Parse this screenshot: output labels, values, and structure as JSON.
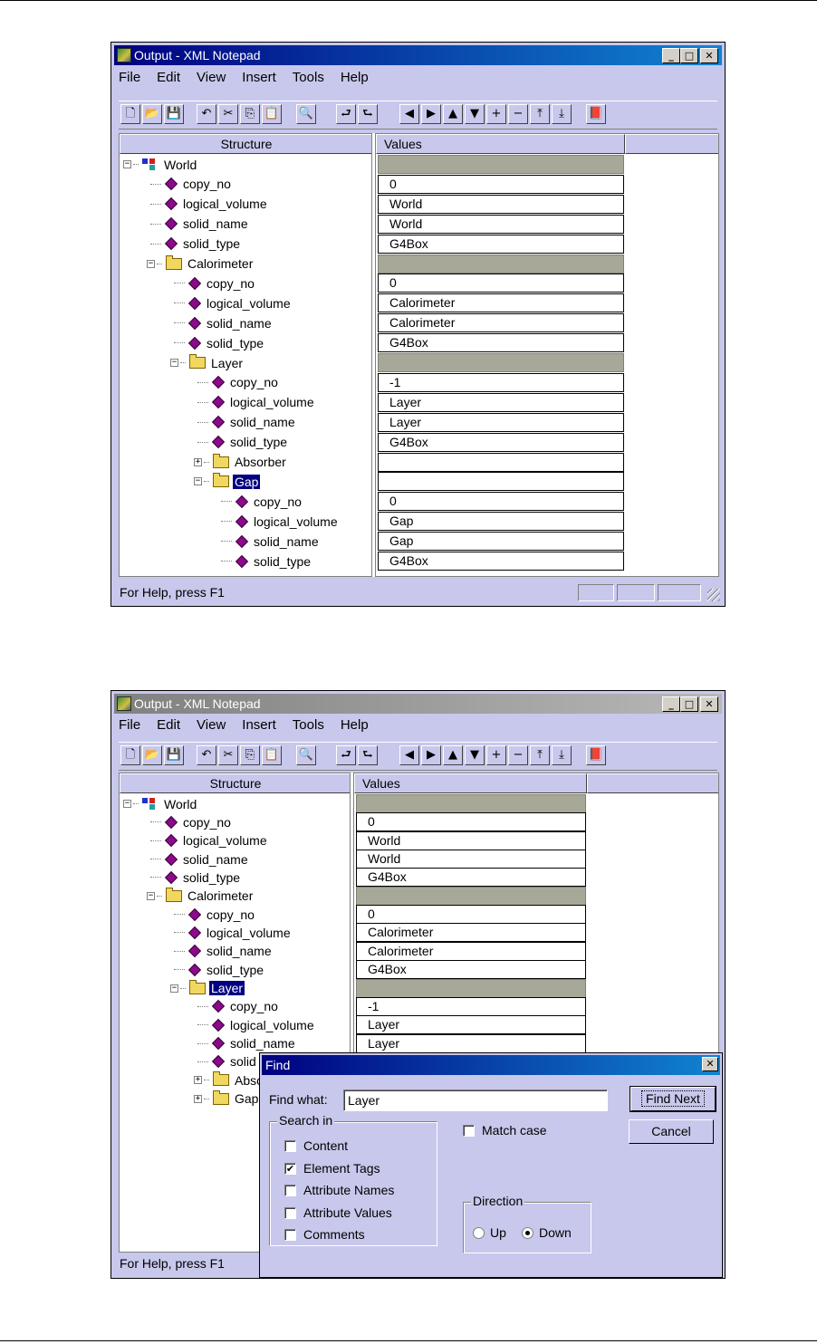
{
  "screen1": {
    "title": "Output - XML Notepad",
    "menu": [
      "File",
      "Edit",
      "View",
      "Insert",
      "Tools",
      "Help"
    ],
    "headers": {
      "structure": "Structure",
      "values": "Values"
    },
    "status": "For Help, press F1",
    "rows": [
      {
        "label": "World",
        "type": "root",
        "value": ""
      },
      {
        "label": "copy_no",
        "type": "attr",
        "value": "0"
      },
      {
        "label": "logical_volume",
        "type": "attr",
        "value": "World"
      },
      {
        "label": "solid_name",
        "type": "attr",
        "value": "World"
      },
      {
        "label": "solid_type",
        "type": "attr",
        "value": "G4Box"
      },
      {
        "label": "Calorimeter",
        "type": "folder",
        "value": ""
      },
      {
        "label": "copy_no",
        "type": "attr",
        "value": "0"
      },
      {
        "label": "logical_volume",
        "type": "attr",
        "value": "Calorimeter"
      },
      {
        "label": "solid_name",
        "type": "attr",
        "value": "Calorimeter"
      },
      {
        "label": "solid_type",
        "type": "attr",
        "value": "G4Box"
      },
      {
        "label": "Layer",
        "type": "folder",
        "value": ""
      },
      {
        "label": "copy_no",
        "type": "attr",
        "value": "-1"
      },
      {
        "label": "logical_volume",
        "type": "attr",
        "value": "Layer"
      },
      {
        "label": "solid_name",
        "type": "attr",
        "value": "Layer"
      },
      {
        "label": "solid_type",
        "type": "attr",
        "value": "G4Box"
      },
      {
        "label": "Absorber",
        "type": "folder-collapsed",
        "value": ""
      },
      {
        "label": "Gap",
        "type": "folder",
        "value": ""
      },
      {
        "label": "copy_no",
        "type": "attr",
        "value": "0"
      },
      {
        "label": "logical_volume",
        "type": "attr",
        "value": "Gap"
      },
      {
        "label": "solid_name",
        "type": "attr",
        "value": "Gap"
      },
      {
        "label": "solid_type",
        "type": "attr",
        "value": "G4Box"
      }
    ]
  },
  "screen2": {
    "title": "Output - XML Notepad",
    "menu": [
      "File",
      "Edit",
      "View",
      "Insert",
      "Tools",
      "Help"
    ],
    "headers": {
      "structure": "Structure",
      "values": "Values"
    },
    "status": "For Help, press F1",
    "rows": [
      {
        "label": "World",
        "type": "root",
        "value": ""
      },
      {
        "label": "copy_no",
        "type": "attr",
        "value": "0"
      },
      {
        "label": "logical_volume",
        "type": "attr",
        "value": "World"
      },
      {
        "label": "solid_name",
        "type": "attr",
        "value": "World"
      },
      {
        "label": "solid_type",
        "type": "attr",
        "value": "G4Box"
      },
      {
        "label": "Calorimeter",
        "type": "folder",
        "value": ""
      },
      {
        "label": "copy_no",
        "type": "attr",
        "value": "0"
      },
      {
        "label": "logical_volume",
        "type": "attr",
        "value": "Calorimeter"
      },
      {
        "label": "solid_name",
        "type": "attr",
        "value": "Calorimeter"
      },
      {
        "label": "solid_type",
        "type": "attr",
        "value": "G4Box"
      },
      {
        "label": "Layer",
        "type": "folder",
        "value": ""
      },
      {
        "label": "copy_no",
        "type": "attr",
        "value": "-1"
      },
      {
        "label": "logical_volume",
        "type": "attr",
        "value": "Layer"
      },
      {
        "label": "solid_name",
        "type": "attr",
        "value": "Layer"
      },
      {
        "label": "solid",
        "type": "attr",
        "value": ""
      },
      {
        "label": "Abso",
        "type": "folder-collapsed",
        "value": ""
      },
      {
        "label": "Gap",
        "type": "folder-collapsed",
        "value": ""
      }
    ],
    "find_dialog": {
      "title": "Find",
      "find_what_label": "Find what:",
      "find_what_value": "Layer",
      "find_next_label": "Find Next",
      "cancel_label": "Cancel",
      "search_in_label": "Search in",
      "options": [
        {
          "label": "Content",
          "checked": false
        },
        {
          "label": "Element Tags",
          "checked": true
        },
        {
          "label": "Attribute Names",
          "checked": false
        },
        {
          "label": "Attribute Values",
          "checked": false
        },
        {
          "label": "Comments",
          "checked": false
        }
      ],
      "match_case_label": "Match case",
      "match_case_checked": false,
      "direction_label": "Direction",
      "up_label": "Up",
      "down_label": "Down",
      "direction_selected": "Down"
    }
  },
  "toolbar_icons": [
    "new-icon",
    "open-icon",
    "save-icon",
    "undo-icon",
    "cut-icon",
    "copy-icon",
    "paste-icon",
    "find-icon",
    "insert-element-icon",
    "insert-child-icon",
    "move-left-icon",
    "move-right-icon",
    "move-up-icon",
    "move-down-icon",
    "expand-icon",
    "collapse-icon",
    "top-align-icon",
    "bottom-align-icon",
    "help-book-icon"
  ],
  "colors": {
    "title_active": "#000080",
    "window_bg": "#c8c8ec",
    "group_cell": "#a8a898",
    "attr_icon": "#8a0a8a",
    "folder": "#f0d860"
  }
}
